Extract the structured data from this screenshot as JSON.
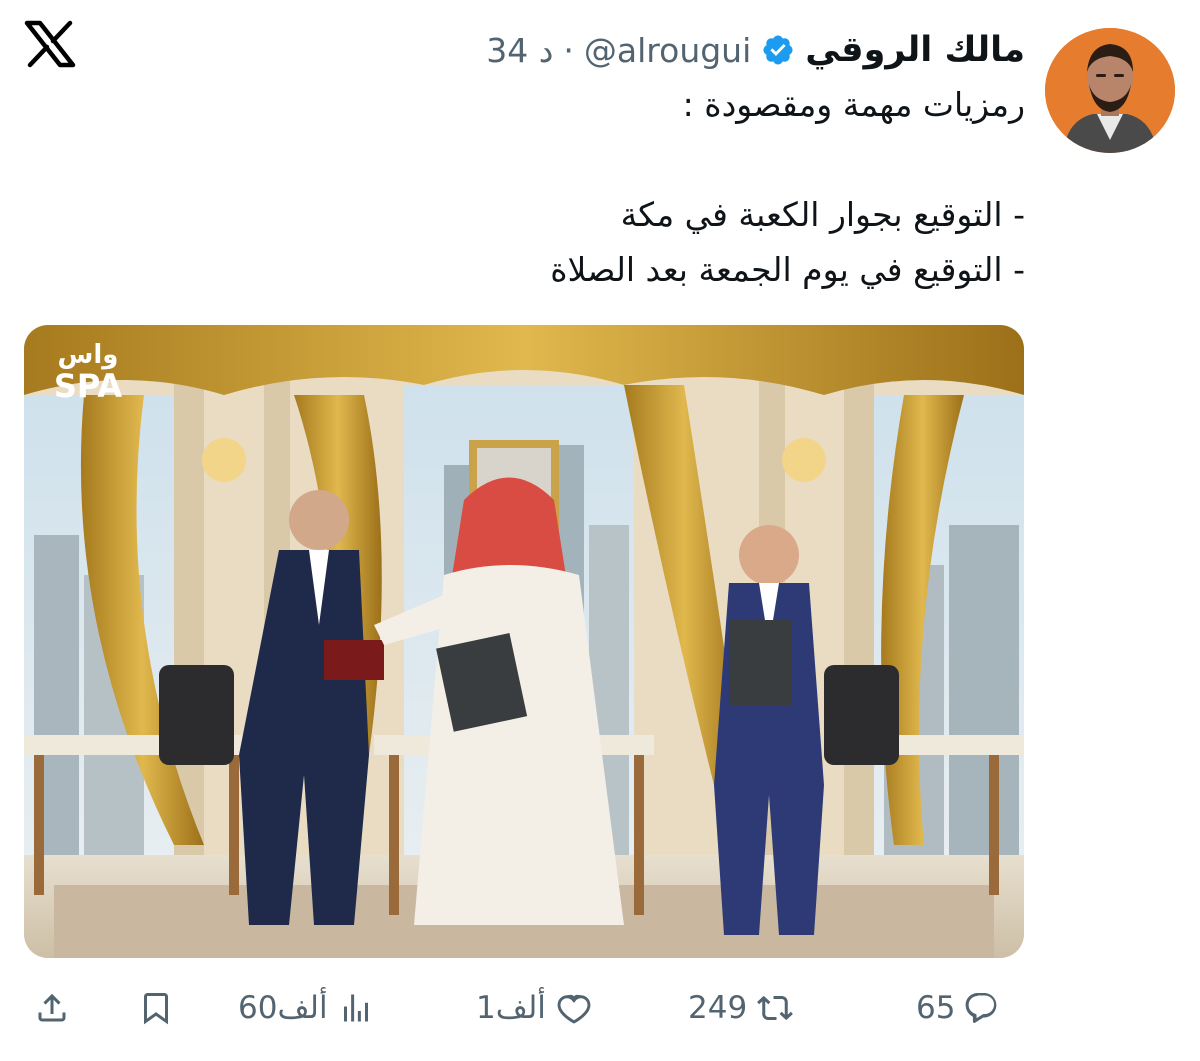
{
  "tweet": {
    "author_name": "مالك الروقي",
    "handle": "@alrougui",
    "separator": "·",
    "time": "34 د",
    "text_lines": [
      "رمزيات مهمة ومقصودة :",
      "- التوقيع بجوار الكعبة في مكة",
      "- التوقيع في يوم الجمعة بعد الصلاة"
    ],
    "media": {
      "watermark_top": "واس",
      "watermark_bottom": "SPA"
    }
  },
  "actions": {
    "replies": "65",
    "retweets": "249",
    "likes": "1ألف",
    "views": "60ألف"
  },
  "icons": {
    "brand": "x-logo-icon",
    "verified": "verified-badge-icon",
    "reply": "reply-icon",
    "retweet": "retweet-icon",
    "like": "heart-icon",
    "views": "views-chart-icon",
    "bookmark": "bookmark-icon",
    "share": "share-icon"
  },
  "colors": {
    "verified_blue": "#1d9bf0",
    "text_primary": "#0f1419",
    "text_secondary": "#536471",
    "avatar_background": "#e57c2e"
  }
}
